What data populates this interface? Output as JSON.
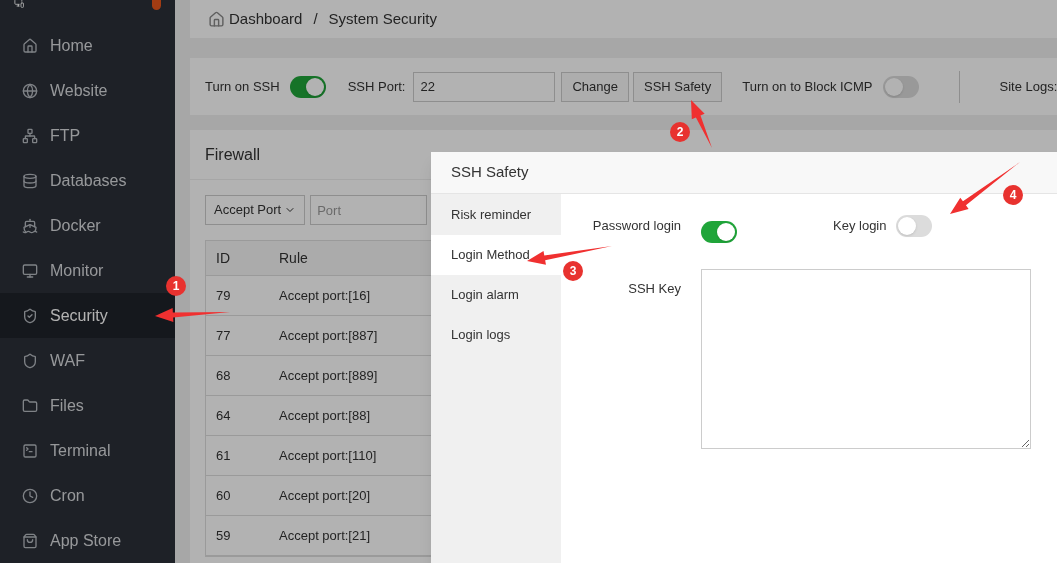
{
  "sidebar": {
    "items": [
      {
        "label": "Home",
        "selected": false
      },
      {
        "label": "Website",
        "selected": false
      },
      {
        "label": "FTP",
        "selected": false
      },
      {
        "label": "Databases",
        "selected": false
      },
      {
        "label": "Docker",
        "selected": false
      },
      {
        "label": "Monitor",
        "selected": false
      },
      {
        "label": "Security",
        "selected": true
      },
      {
        "label": "WAF",
        "selected": false
      },
      {
        "label": "Files",
        "selected": false
      },
      {
        "label": "Terminal",
        "selected": false
      },
      {
        "label": "Cron",
        "selected": false
      },
      {
        "label": "App Store",
        "selected": false
      }
    ]
  },
  "breadcrumb": [
    "Dashboard",
    "System Security"
  ],
  "breadcrumb_separator": "/",
  "toolbar": {
    "ssh_label": "Turn on SSH",
    "ssh_on": true,
    "port_label": "SSH Port:",
    "port_value": "22",
    "change_button": "Change",
    "safety_button": "SSH Safety",
    "icmp_label": "Turn on to Block ICMP",
    "icmp_on": false,
    "site_logs_label": "Site Logs:"
  },
  "firewall": {
    "title": "Firewall",
    "filter_select": "Accept Port",
    "port_placeholder": "Port",
    "columns": [
      "ID",
      "Rule"
    ],
    "rows": [
      [
        "79",
        "Accept port:[16]"
      ],
      [
        "77",
        "Accept port:[887]"
      ],
      [
        "68",
        "Accept port:[889]"
      ],
      [
        "64",
        "Accept port:[88]"
      ],
      [
        "61",
        "Accept port:[110]"
      ],
      [
        "60",
        "Accept port:[20]"
      ],
      [
        "59",
        "Accept port:[21]"
      ]
    ]
  },
  "dialog": {
    "title": "SSH Safety",
    "menu": [
      {
        "label": "Risk reminder",
        "selected": false
      },
      {
        "label": "Login Method",
        "selected": true
      },
      {
        "label": "Login alarm",
        "selected": false
      },
      {
        "label": "Login logs",
        "selected": false
      }
    ],
    "password_login_label": "Password login",
    "password_login_on": true,
    "key_login_label": "Key login",
    "key_login_on": false,
    "ssh_key_label": "SSH Key"
  },
  "annotations": [
    "1",
    "2",
    "3",
    "4"
  ]
}
